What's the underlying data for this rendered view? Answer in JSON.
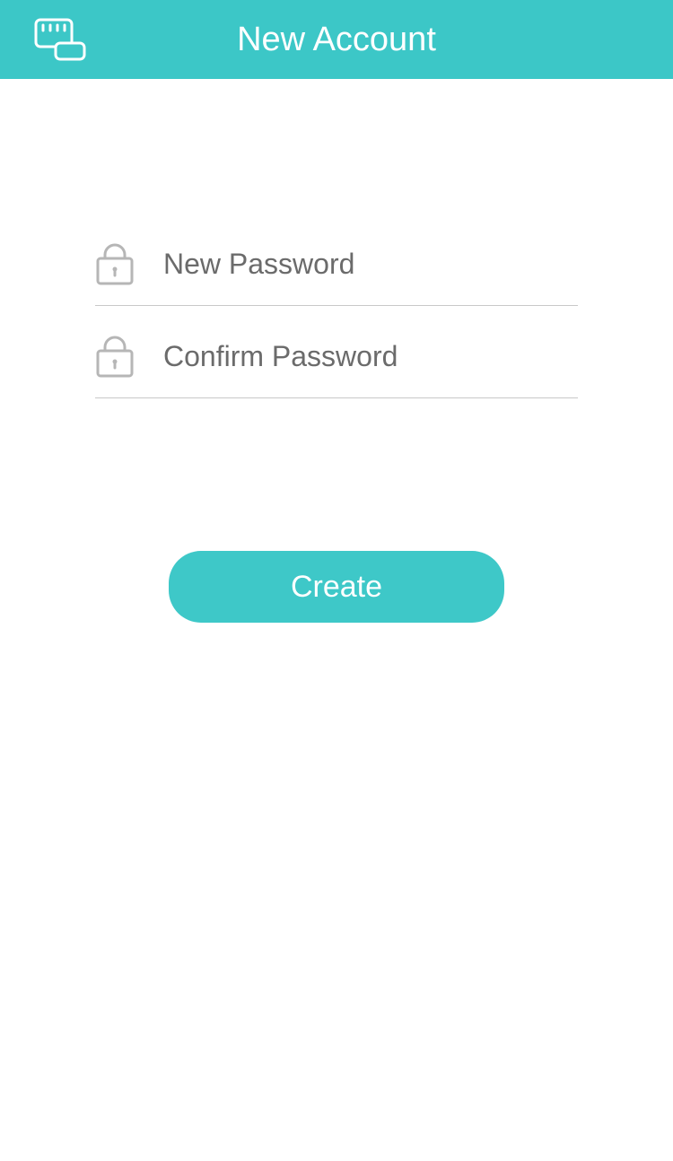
{
  "header": {
    "title": "New Account"
  },
  "form": {
    "new_password_placeholder": "New Password",
    "new_password_value": "",
    "confirm_password_placeholder": "Confirm Password",
    "confirm_password_value": "",
    "create_button_label": "Create"
  },
  "colors": {
    "accent": "#3cc7c7"
  },
  "icons": {
    "keyboard": "keyboard-icon",
    "lock": "lock-icon"
  }
}
